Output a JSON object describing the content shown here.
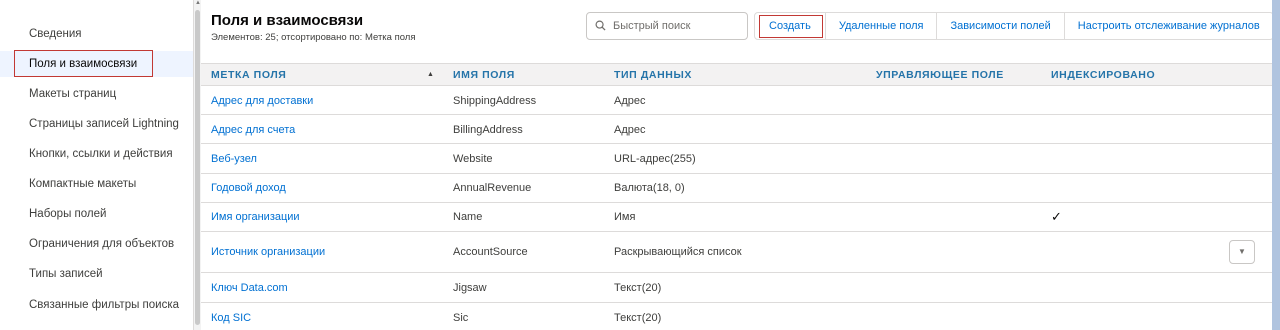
{
  "sidebar": {
    "items": [
      {
        "label": "Сведения"
      },
      {
        "label": "Поля и взаимосвязи"
      },
      {
        "label": "Макеты страниц"
      },
      {
        "label": "Страницы записей Lightning"
      },
      {
        "label": "Кнопки, ссылки и действия"
      },
      {
        "label": "Компактные макеты"
      },
      {
        "label": "Наборы полей"
      },
      {
        "label": "Ограничения для объектов"
      },
      {
        "label": "Типы записей"
      },
      {
        "label": "Связанные фильтры поиска"
      }
    ],
    "active_index": 1
  },
  "header": {
    "title": "Поля и взаимосвязи",
    "subtitle": "Элементов: 25; отсортировано по: Метка поля"
  },
  "search": {
    "placeholder": "Быстрый поиск",
    "icon": "search-icon"
  },
  "toolbar": {
    "buttons": [
      {
        "label": "Создать"
      },
      {
        "label": "Удаленные поля"
      },
      {
        "label": "Зависимости полей"
      },
      {
        "label": "Настроить отслеживание журналов"
      }
    ]
  },
  "table": {
    "columns": [
      "МЕТКА ПОЛЯ",
      "ИМЯ ПОЛЯ",
      "ТИП ДАННЫХ",
      "УПРАВЛЯЮЩЕЕ ПОЛЕ",
      "ИНДЕКСИРОВАНО"
    ],
    "sort_indicator": "▲",
    "rows": [
      {
        "label": "Адрес для доставки",
        "api": "ShippingAddress",
        "type": "Адрес",
        "indexed": false
      },
      {
        "label": "Адрес для счета",
        "api": "BillingAddress",
        "type": "Адрес",
        "indexed": false
      },
      {
        "label": "Веб-узел",
        "api": "Website",
        "type": "URL-адрес(255)",
        "indexed": false
      },
      {
        "label": "Годовой доход",
        "api": "AnnualRevenue",
        "type": "Валюта(18, 0)",
        "indexed": false
      },
      {
        "label": "Имя организации",
        "api": "Name",
        "type": "Имя",
        "indexed": true
      },
      {
        "label": "Источник организации",
        "api": "AccountSource",
        "type": "Раскрывающийся список",
        "indexed": false
      },
      {
        "label": "Ключ Data.com",
        "api": "Jigsaw",
        "type": "Текст(20)",
        "indexed": false
      },
      {
        "label": "Код SIC",
        "api": "Sic",
        "type": "Текст(20)",
        "indexed": false
      }
    ],
    "check_glyph": "✓",
    "dropdown_glyph": "▼"
  },
  "colors": {
    "link": "#0070d2",
    "header_text": "#2574a9",
    "highlight_outline": "#c23934",
    "background": "#b0c4df"
  }
}
